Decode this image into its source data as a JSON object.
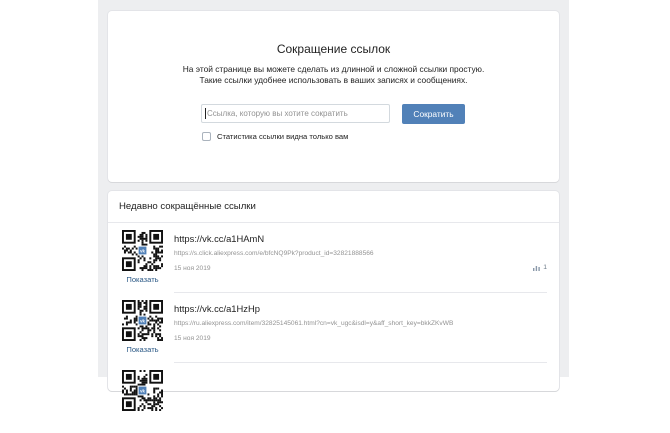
{
  "shortener": {
    "title": "Сокращение ссылок",
    "description_line1": "На этой странице вы можете сделать из длинной и сложной ссылки простую.",
    "description_line2": "Такие ссылки удобнее использовать в ваших записях и сообщениях.",
    "input_placeholder": "Ссылка, которую вы хотите сократить",
    "input_value": "",
    "submit_label": "Сократить",
    "stats_private_label": "Статистика ссылки видна только вам",
    "stats_private_checked": false
  },
  "recent": {
    "title": "Недавно сокращённые ссылки",
    "items": [
      {
        "short_url": "https://vk.cc/a1HAmN",
        "original_url": "https://s.click.aliexpress.com/e/bfcNQ9Pk?product_id=32821888566",
        "date": "15 ноя 2019",
        "show_label": "Показать",
        "views": "1",
        "stats_icon": "bar-chart-icon"
      },
      {
        "short_url": "https://vk.cc/a1HzHp",
        "original_url": "https://ru.aliexpress.com/item/32825145061.html?cn=vk_ugc&isdl=y&aff_short_key=bkkZKvWB",
        "date": "15 ноя 2019",
        "show_label": "Показать",
        "views": "",
        "stats_icon": ""
      },
      {
        "short_url": "",
        "original_url": "",
        "date": "",
        "show_label": "",
        "views": "",
        "stats_icon": ""
      }
    ]
  },
  "colors": {
    "accent": "#5181b8",
    "link": "#2a5885",
    "page_bg": "#edeef0",
    "muted_text": "#939393"
  }
}
